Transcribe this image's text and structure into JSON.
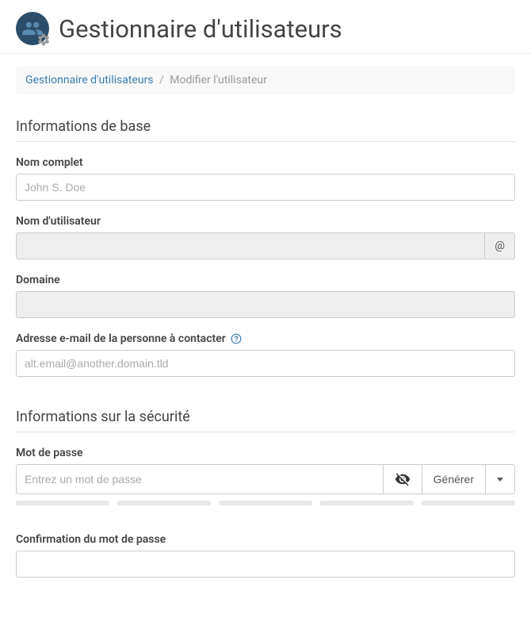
{
  "header": {
    "title": "Gestionnaire d'utilisateurs"
  },
  "breadcrumb": {
    "root": "Gestionnaire d'utilisateurs",
    "current": "Modifier l'utilisateur"
  },
  "sections": {
    "basic": {
      "title": "Informations de base",
      "fields": {
        "fullname": {
          "label": "Nom complet",
          "placeholder": "John S. Doe"
        },
        "username": {
          "label": "Nom d'utilisateur",
          "addon": "@"
        },
        "domain": {
          "label": "Domaine"
        },
        "contact_email": {
          "label": "Adresse e-mail de la personne à contacter",
          "placeholder": "alt.email@another.domain.tld"
        }
      }
    },
    "security": {
      "title": "Informations sur la sécurité",
      "fields": {
        "password": {
          "label": "Mot de passe",
          "placeholder": "Entrez un mot de passe",
          "generate": "Générer"
        },
        "confirm": {
          "label": "Confirmation du mot de passe"
        }
      }
    }
  }
}
